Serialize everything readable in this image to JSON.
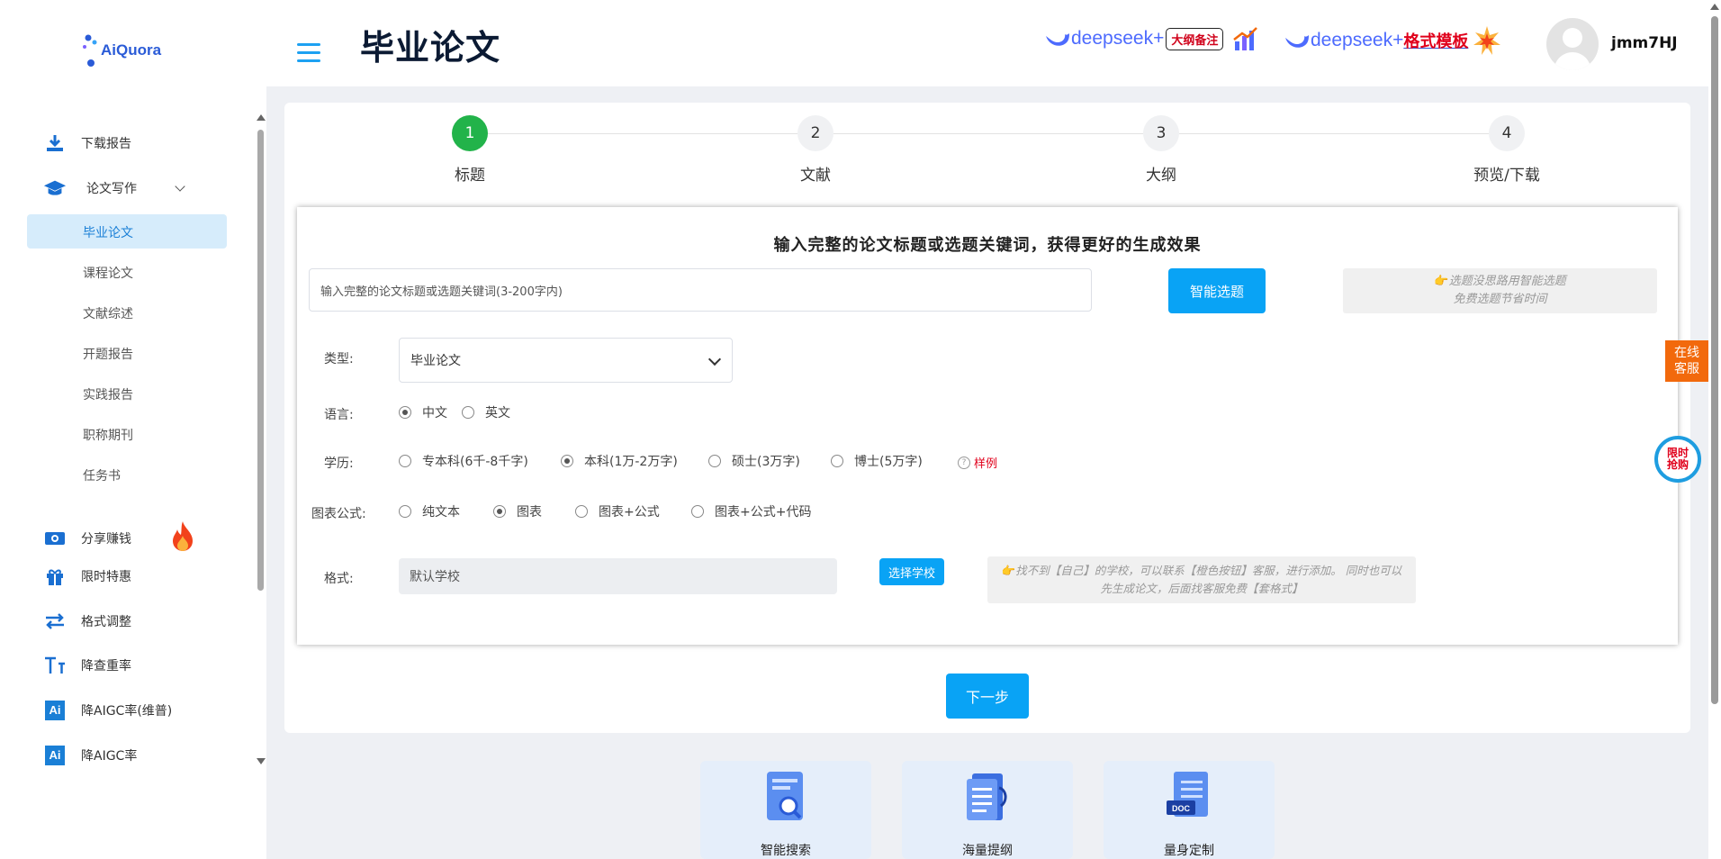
{
  "app": {
    "logo_text": "AiQuora"
  },
  "sidebar": {
    "items": [
      {
        "label": "下载报告",
        "icon": "download-icon"
      },
      {
        "label": "论文写作",
        "icon": "graduation-cap-icon"
      },
      {
        "label": "分享赚钱",
        "icon": "money-icon"
      },
      {
        "label": "限时特惠",
        "icon": "gift-icon"
      },
      {
        "label": "格式调整",
        "icon": "swap-icon"
      },
      {
        "label": "降查重率",
        "icon": "text-format-icon"
      },
      {
        "label": "降AIGC率(维普)",
        "icon": "ai-icon"
      },
      {
        "label": "降AIGC率",
        "icon": "ai-icon"
      }
    ],
    "subitems": [
      "毕业论文",
      "课程论文",
      "文献综述",
      "开题报告",
      "实践报告",
      "职称期刊",
      "任务书"
    ],
    "active_subitem": "毕业论文"
  },
  "header": {
    "title": "毕业论文",
    "banner1": {
      "brand": "deepseek+",
      "tag": "大纲备注"
    },
    "banner2": {
      "brand": "deepseek+",
      "tag": "格式模板"
    },
    "username": "jmm7HJ"
  },
  "steps": [
    {
      "num": "1",
      "label": "标题",
      "active": true
    },
    {
      "num": "2",
      "label": "文献",
      "active": false
    },
    {
      "num": "3",
      "label": "大纲",
      "active": false
    },
    {
      "num": "4",
      "label": "预览/下载",
      "active": false
    }
  ],
  "form": {
    "title": "输入完整的论文标题或选题关键词，获得更好的生成效果",
    "topic_placeholder": "输入完整的论文标题或选题关键词(3-200字内)",
    "smart_button": "智能选题",
    "smart_tip_line1": "选题没思路用智能选题",
    "smart_tip_line2": "免费选题节省时间",
    "type_label": "类型:",
    "type_value": "毕业论文",
    "language_label": "语言:",
    "language_options": [
      "中文",
      "英文"
    ],
    "language_selected": "中文",
    "degree_label": "学历:",
    "degree_options": [
      "专本科(6千-8千字)",
      "本科(1万-2万字)",
      "硕士(3万字)",
      "博士(5万字)"
    ],
    "degree_selected": "本科(1万-2万字)",
    "sample_link": "样例",
    "chart_label": "图表公式:",
    "chart_options": [
      "纯文本",
      "图表",
      "图表+公式",
      "图表+公式+代码"
    ],
    "chart_selected": "图表",
    "format_label": "格式:",
    "format_value": "默认学校",
    "choose_school_button": "选择学校",
    "format_tip_line1": "找不到【自己】的学校，可以联系【橙色按钮】客服，进行添加。 同时也可以",
    "format_tip_line2": "先生成论文，后面找客服免费【套格式】"
  },
  "next_button": "下一步",
  "features": [
    {
      "label": "智能搜索",
      "icon": "search-doc-icon"
    },
    {
      "label": "海量提纲",
      "icon": "outline-icon"
    },
    {
      "label": "量身定制",
      "icon": "doc-icon"
    }
  ],
  "float": {
    "service_line1": "在线",
    "service_line2": "客服",
    "promo_line1": "限时",
    "promo_line2": "抢购"
  },
  "colors": {
    "accent": "#09a3f5",
    "step_active": "#22b34a",
    "service": "#f2690c",
    "sample": "#e0001b"
  }
}
